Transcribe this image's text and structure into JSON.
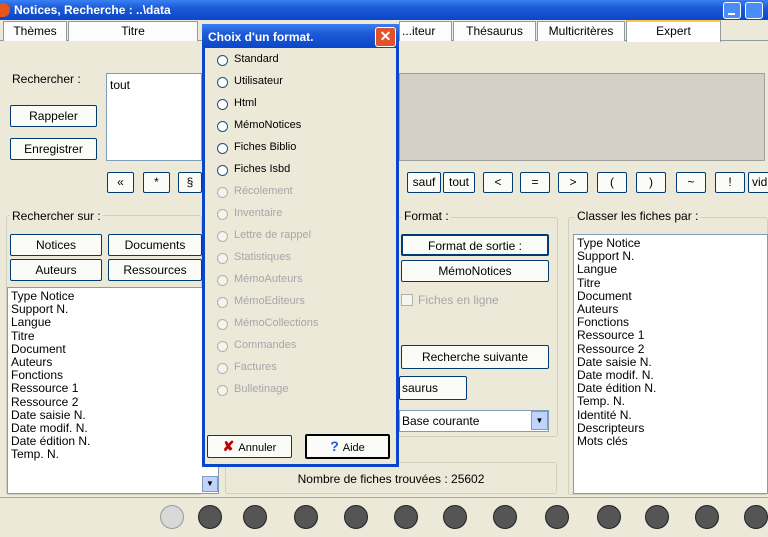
{
  "window": {
    "title": "Notices, Recherche : ..\\data"
  },
  "tabs": [
    {
      "label": "Thèmes"
    },
    {
      "label": "Titre"
    },
    {
      "label": "...iteur"
    },
    {
      "label": "Thésaurus"
    },
    {
      "label": "Multicritères"
    },
    {
      "label": "Expert"
    }
  ],
  "search": {
    "label": "Rechercher :",
    "value": "tout",
    "recall_label": "Rappeler",
    "save_label": "Enregistrer"
  },
  "operators": [
    "«",
    "*",
    "§",
    "sauf",
    "tout",
    "<",
    "=",
    ">",
    "(",
    ")",
    "~",
    "!",
    "vid"
  ],
  "search_on": {
    "legend": "Rechercher sur :",
    "buttons": [
      "Notices",
      "Documents",
      "Auteurs",
      "Ressources"
    ],
    "fields": [
      "Type Notice",
      "Support N.",
      "Langue",
      "Titre",
      "Document",
      "Auteurs",
      "Fonctions",
      "Ressource 1",
      "Ressource 2",
      "Date saisie N.",
      "Date modif. N.",
      "Date édition N.",
      "Temp. N."
    ]
  },
  "format": {
    "legend": "Format :",
    "output_button": "Format de sortie :",
    "current_format": "MémoNotices",
    "online_label": "Fiches en ligne",
    "next_search": "Recherche suivante",
    "thesaurus_button": "saurus",
    "base_select": "Base courante"
  },
  "sort": {
    "legend": "Classer les fiches par :",
    "fields": [
      "Type Notice",
      "Support N.",
      "Langue",
      "Titre",
      "Document",
      "Auteurs",
      "Fonctions",
      "Ressource 1",
      "Ressource 2",
      "Date saisie N.",
      "Date modif. N.",
      "Date édition N.",
      "Temp. N.",
      "Identité N.",
      "Descripteurs",
      "Mots clés"
    ]
  },
  "status": {
    "count_text": "Nombre de fiches trouvées : 25602"
  },
  "dialog": {
    "title": "Choix d'un format.",
    "options": [
      {
        "label": "Standard",
        "enabled": true
      },
      {
        "label": "Utilisateur",
        "enabled": true
      },
      {
        "label": "Html",
        "enabled": true
      },
      {
        "label": "MémoNotices",
        "enabled": true
      },
      {
        "label": "Fiches Biblio",
        "enabled": true
      },
      {
        "label": "Fiches Isbd",
        "enabled": true
      },
      {
        "label": "Récolement",
        "enabled": false
      },
      {
        "label": "Inventaire",
        "enabled": false
      },
      {
        "label": "Lettre de rappel",
        "enabled": false
      },
      {
        "label": "Statistiques",
        "enabled": false
      },
      {
        "label": "MémoAuteurs",
        "enabled": false
      },
      {
        "label": "MémoEditeurs",
        "enabled": false
      },
      {
        "label": "MémoCollections",
        "enabled": false
      },
      {
        "label": "Commandes",
        "enabled": false
      },
      {
        "label": "Factures",
        "enabled": false
      },
      {
        "label": "Bulletinage",
        "enabled": false
      }
    ],
    "cancel_label": "Annuler",
    "help_label": "Aide"
  },
  "toolbar_icons": [
    "back-icon",
    "settings-icon",
    "shuffle-icon",
    "text-style-icon",
    "refresh-icon",
    "grid-icon",
    "import-icon",
    "export-icon",
    "trash-icon",
    "view-icon",
    "note-icon",
    "close-icon",
    "help-icon"
  ],
  "colors": {
    "titlebar": "#0a46c9",
    "face": "#ece9d8",
    "close_button": "#e2512a"
  }
}
